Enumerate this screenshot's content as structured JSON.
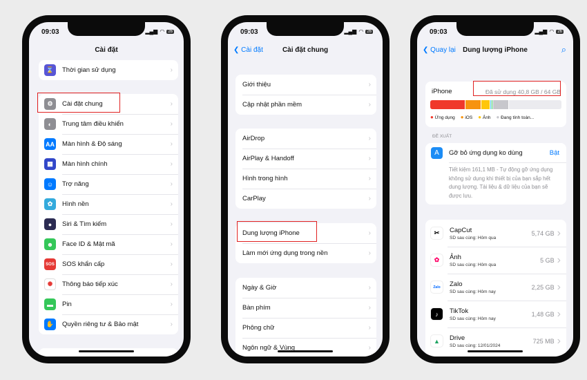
{
  "status": {
    "time": "09:03",
    "battery": "26"
  },
  "phone1": {
    "title": "Cài đặt",
    "group1": [
      {
        "label": "Thời gian sử dụng",
        "icon": "hourglass-icon",
        "color": "#5856d6",
        "glyph": "⌛"
      }
    ],
    "group2": [
      {
        "label": "Cài đặt chung",
        "icon": "gear-icon",
        "color": "#8e8e93",
        "glyph": "⚙"
      },
      {
        "label": "Trung tâm điều khiển",
        "icon": "toggles-icon",
        "color": "#8e8e93",
        "glyph": "◐"
      },
      {
        "label": "Màn hình & Độ sáng",
        "icon": "display-brightness-icon",
        "color": "#007aff",
        "glyph": "AA"
      },
      {
        "label": "Màn hình chính",
        "icon": "home-screen-icon",
        "color": "#3147c9",
        "glyph": "▦"
      },
      {
        "label": "Trợ năng",
        "icon": "accessibility-icon",
        "color": "#007aff",
        "glyph": "☺"
      },
      {
        "label": "Hình nền",
        "icon": "wallpaper-icon",
        "color": "#34aadc",
        "glyph": "✿"
      },
      {
        "label": "Siri & Tìm kiếm",
        "icon": "siri-icon",
        "color": "#2b2b52",
        "glyph": "●"
      },
      {
        "label": "Face ID & Mật mã",
        "icon": "face-id-icon",
        "color": "#34c759",
        "glyph": "☻"
      },
      {
        "label": "SOS khẩn cấp",
        "icon": "sos-icon",
        "color": "#e53935",
        "glyph": "SOS"
      },
      {
        "label": "Thông báo tiếp xúc",
        "icon": "exposure-icon",
        "color": "#ffffff",
        "glyph": "✺"
      },
      {
        "label": "Pin",
        "icon": "battery-icon",
        "color": "#34c759",
        "glyph": "▬"
      },
      {
        "label": "Quyền riêng tư & Bảo mật",
        "icon": "hand-icon",
        "color": "#007aff",
        "glyph": "✋"
      }
    ]
  },
  "phone2": {
    "back": "Cài đặt",
    "title": "Cài đặt chung",
    "groups": [
      [
        "Giới thiệu",
        "Cập nhật phần mềm"
      ],
      [
        "AirDrop",
        "AirPlay & Handoff",
        "Hình trong hình",
        "CarPlay"
      ],
      [
        "Dung lượng iPhone",
        "Làm mới ứng dụng trong nền"
      ],
      [
        "Ngày & Giờ",
        "Bàn phím",
        "Phông chữ",
        "Ngôn ngữ & Vùng"
      ]
    ]
  },
  "phone3": {
    "back": "Quay lại",
    "title": "Dung lượng iPhone",
    "device": "iPhone",
    "used": "Đã sử dụng 40,8 GB / 64 GB",
    "bar": [
      {
        "name": "Ứng dụng",
        "color": "#f0382b",
        "fraction": 0.27
      },
      {
        "name": "iOS",
        "color": "#f7930f",
        "fraction": 0.12
      },
      {
        "name": "Ảnh",
        "color": "#ffc60a",
        "fraction": 0.07
      },
      {
        "name": "other1",
        "color": "#5ac8fa",
        "fraction": 0.01
      },
      {
        "name": "other2",
        "color": "#34c759",
        "fraction": 0.01
      },
      {
        "name": "Đang tính toán...",
        "color": "#c7c7cc",
        "fraction": 0.12
      }
    ],
    "legend": [
      {
        "label": "Ứng dụng",
        "color": "#f0382b"
      },
      {
        "label": "iOS",
        "color": "#f7930f"
      },
      {
        "label": "Ảnh",
        "color": "#ffc60a"
      },
      {
        "label": "Đang tính toán...",
        "color": "#c7c7cc"
      }
    ],
    "section": "ĐỀ XUẤT",
    "rec": {
      "title": "Gỡ bỏ ứng dụng ko dùng",
      "action": "Bật",
      "desc": "Tiết kiệm 161,1 MB - Tự động gỡ ứng dụng không sử dụng khi thiết bị của bạn sắp hết dung lượng. Tài liệu & dữ liệu của bạn sẽ được lưu."
    },
    "apps": [
      {
        "name": "CapCut",
        "last": "SD sau cùng: Hôm qua",
        "size": "5,74 GB",
        "icon": "capcut-icon",
        "bg": "#ffffff",
        "fg": "#000",
        "glyph": "✂"
      },
      {
        "name": "Ảnh",
        "last": "SD sau cùng: Hôm qua",
        "size": "5 GB",
        "icon": "photos-icon",
        "bg": "#ffffff",
        "fg": "#f06",
        "glyph": "✿"
      },
      {
        "name": "Zalo",
        "last": "SD sau cùng: Hôm nay",
        "size": "2,25 GB",
        "icon": "zalo-icon",
        "bg": "#ffffff",
        "fg": "#0068ff",
        "glyph": "Zalo"
      },
      {
        "name": "TikTok",
        "last": "SD sau cùng: Hôm nay",
        "size": "1,48 GB",
        "icon": "tiktok-icon",
        "bg": "#000000",
        "fg": "#fff",
        "glyph": "♪"
      },
      {
        "name": "Drive",
        "last": "SD sau cùng: 12/01/2024",
        "size": "725 MB",
        "icon": "drive-icon",
        "bg": "#ffffff",
        "fg": "#1fa463",
        "glyph": "▲"
      }
    ]
  }
}
